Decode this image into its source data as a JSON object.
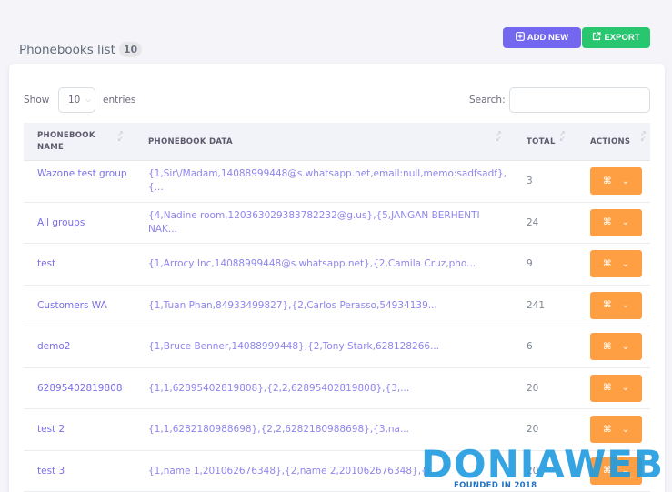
{
  "header": {
    "title": "Phonebooks list",
    "count": "10",
    "add_new_label": "ADD NEW",
    "export_label": "EXPORT"
  },
  "controls": {
    "show_label": "Show",
    "entries_value": "10",
    "entries_label": "entries",
    "search_label": "Search:",
    "search_value": ""
  },
  "table": {
    "columns": [
      "PHONEBOOK NAME",
      "PHONEBOOK DATA",
      "TOTAL",
      "ACTIONS"
    ],
    "rows": [
      {
        "name": "Wazone test group",
        "data": "{1,Sir\\/Madam,14088999448@s.whatsapp.net,email:null,memo:sadfsadf},{...",
        "total": "3"
      },
      {
        "name": "All groups",
        "data": "{4,Nadine room,120363029383782232@g.us},{5,JANGAN BERHENTI NAK...",
        "total": "24"
      },
      {
        "name": "test",
        "data": "{1,Arrocy Inc,14088999448@s.whatsapp.net},{2,Camila Cruz,pho...",
        "total": "9"
      },
      {
        "name": "Customers WA",
        "data": "{1,Tuan Phan,84933499827},{2,Carlos Perasso,54934139...",
        "total": "241"
      },
      {
        "name": "demo2",
        "data": "{1,Bruce Benner,14088999448},{2,Tony Stark,628128266...",
        "total": "6"
      },
      {
        "name": "62895402819808",
        "data": "{1,1,62895402819808},{2,2,62895402819808},{3,...",
        "total": "20"
      },
      {
        "name": "test 2",
        "data": "{1,1,6282180988698},{2,2,6282180988698},{3,na...",
        "total": "20"
      },
      {
        "name": "test 3",
        "data": "{1,name 1,201062676348},{2,name 2,201062676348},{i...",
        "total": "20"
      }
    ]
  },
  "watermark": {
    "text": "DONIAWEB",
    "subtitle": "FOUNDED IN 2018"
  },
  "colors": {
    "primary": "#7367f0",
    "success": "#28c76f",
    "warning": "#ff9f43",
    "link": "#7a6fe8",
    "brand": "#1f9be0"
  }
}
